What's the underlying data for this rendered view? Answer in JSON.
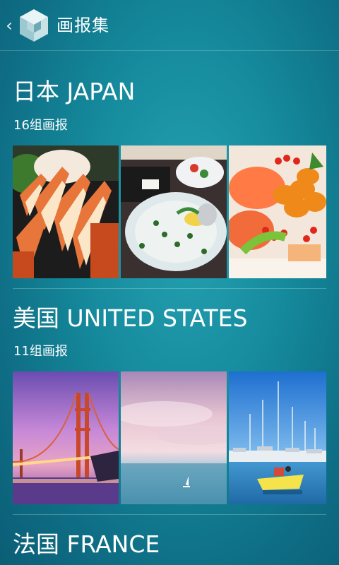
{
  "header": {
    "back_glyph": "‹",
    "back_icon": "chevron-left-icon",
    "logo_icon": "cube-logo-icon",
    "title": "画报集"
  },
  "sections": [
    {
      "title": "日本 JAPAN",
      "count": "16组画报",
      "photos": [
        "crab-legs-photo",
        "sashimi-plate-photo",
        "sea-urchin-rice-bowl-photo"
      ]
    },
    {
      "title": "美国 UNITED STATES",
      "count": "11组画报",
      "photos": [
        "golden-gate-bridge-photo",
        "pink-sky-sea-photo",
        "marina-sailboats-photo"
      ]
    },
    {
      "title": "法国 FRANCE"
    }
  ]
}
